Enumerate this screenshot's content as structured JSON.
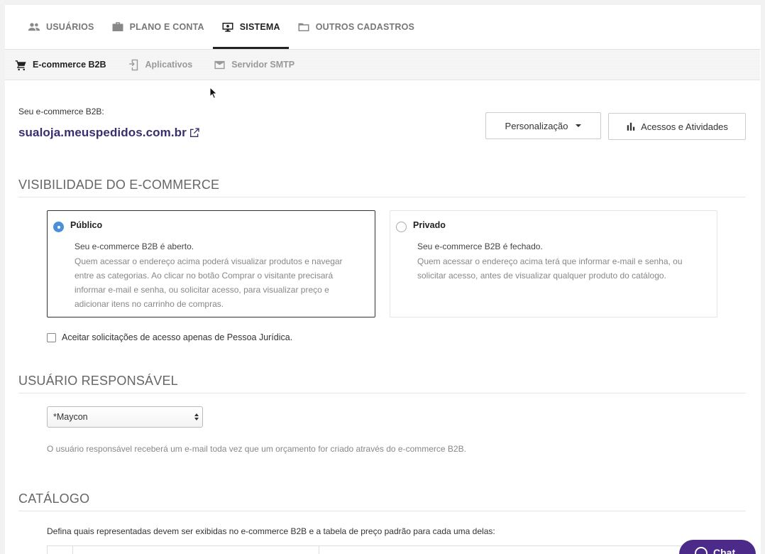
{
  "top_tabs": [
    {
      "label": "USUÁRIOS",
      "icon": "users-icon",
      "active": false
    },
    {
      "label": "PLANO E CONTA",
      "icon": "briefcase-icon",
      "active": false
    },
    {
      "label": "SISTEMA",
      "icon": "monitor-gear-icon",
      "active": true
    },
    {
      "label": "OUTROS CADASTROS",
      "icon": "folder-icon",
      "active": false
    }
  ],
  "sub_tabs": [
    {
      "label": "E-commerce B2B",
      "icon": "cart-icon",
      "active": true
    },
    {
      "label": "Aplicativos",
      "icon": "mobile-app-icon",
      "active": false
    },
    {
      "label": "Servidor SMTP",
      "icon": "mail-icon",
      "active": false
    }
  ],
  "store": {
    "label": "Seu e-commerce B2B:",
    "url": "sualoja.meuspedidos.com.br"
  },
  "buttons": {
    "personalizacao": "Personalização",
    "acessos": "Acessos e Atividades"
  },
  "visibility": {
    "title": "VISIBILIDADE DO E-COMMERCE",
    "public": {
      "title": "Público",
      "lead": "Seu e-commerce B2B é aberto.",
      "desc": "Quem acessar o endereço acima poderá visualizar produtos e navegar entre as categorias. Ao clicar no botão Comprar o visitante precisará informar e-mail e senha, ou solicitar acesso, para visualizar preço e adicionar itens no carrinho de compras.",
      "selected": true
    },
    "private": {
      "title": "Privado",
      "lead": "Seu e-commerce B2B é fechado.",
      "desc": "Quem acessar o endereço acima terá que informar e-mail e senha, ou solicitar acesso, antes de visualizar qualquer produto do catálogo.",
      "selected": false
    },
    "checkbox_label": "Aceitar solicitações de acesso apenas de Pessoa Jurídica.",
    "checkbox_checked": false
  },
  "user_section": {
    "title": "USUÁRIO RESPONSÁVEL",
    "selected_user": "*Maycon",
    "help": "O usuário responsável receberá um e-mail toda vez que um orçamento for criado através do e-commerce B2B."
  },
  "catalog": {
    "title": "CATÁLOGO",
    "desc": "Defina quais representadas devem ser exibidas no e-commerce B2B e a tabela de preço padrão para cada uma delas:"
  },
  "chat": {
    "label": "Chat"
  },
  "colors": {
    "link": "#3a2e6e",
    "radio_on": "#4a90d9",
    "chat_bg": "#4b2a8a"
  }
}
